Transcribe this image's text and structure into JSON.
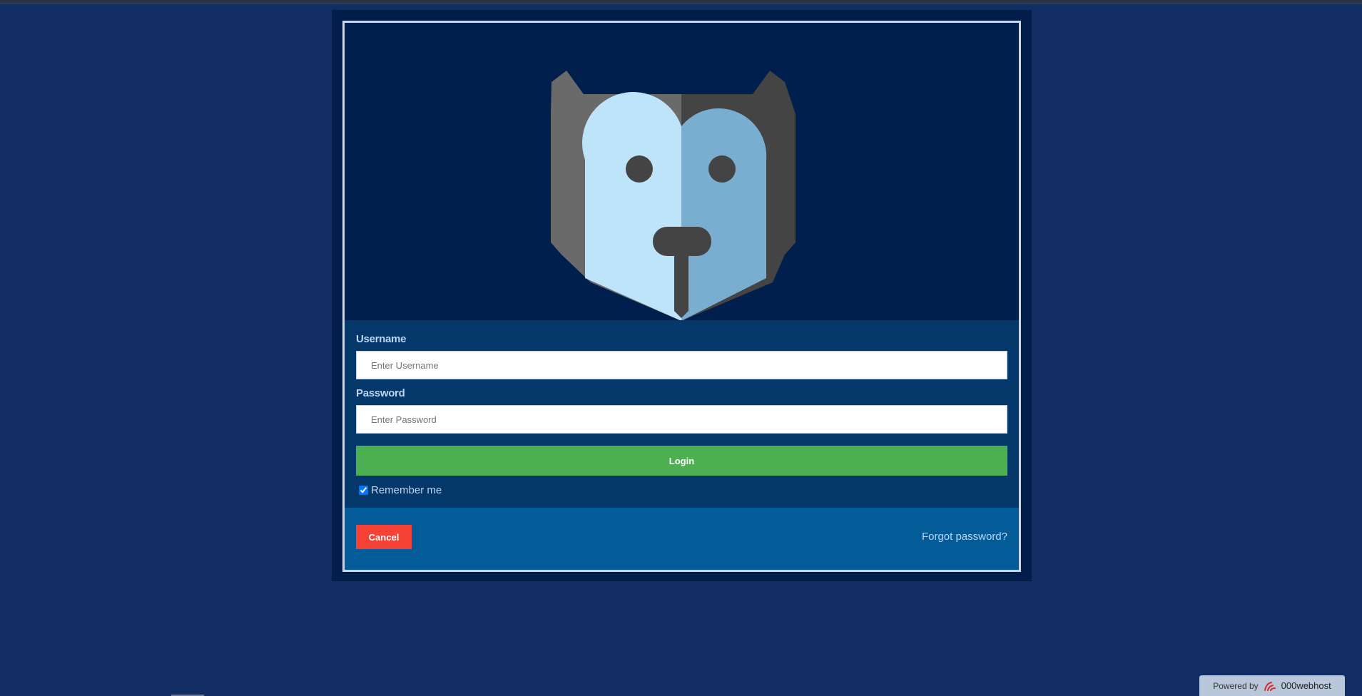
{
  "form": {
    "username_label": "Username",
    "username_placeholder": "Enter Username",
    "password_label": "Password",
    "password_placeholder": "Enter Password",
    "login_label": "Login",
    "remember_label": "Remember me",
    "remember_checked": true
  },
  "footer": {
    "cancel_label": "Cancel",
    "forgot_label": "Forgot password?"
  },
  "powered": {
    "prefix": "Powered by",
    "brand": "000webhost"
  },
  "avatar": {
    "icon": "dog-avatar-icon"
  },
  "colors": {
    "page_bg": "#112d63",
    "login": "#4caf50",
    "cancel": "#f44336",
    "footer_bg": "#035c97"
  }
}
